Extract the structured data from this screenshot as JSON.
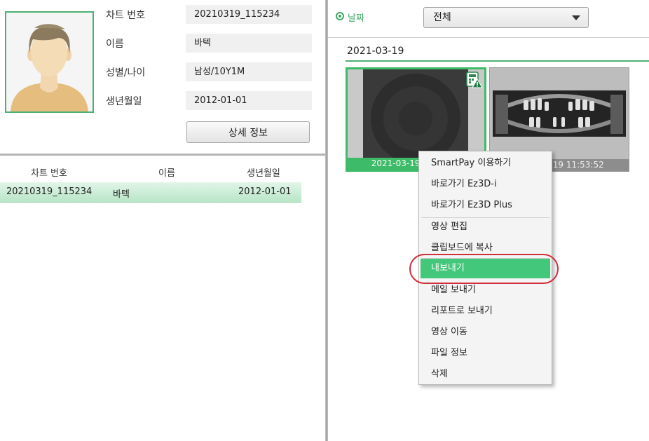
{
  "patient_info": {
    "chart_number_label": "차트 번호",
    "chart_number_value": "20210319_115234",
    "name_label": "이름",
    "name_value": "바텍",
    "gender_age_label": "성별/나이",
    "gender_age_value": "남성/10Y1M",
    "birthdate_label": "생년월일",
    "birthdate_value": "2012-01-01",
    "detail_button": "상세 정보"
  },
  "patient_list": {
    "columns": [
      "차트 번호",
      "이름",
      "생년월일"
    ],
    "rows": [
      {
        "chart_number": "20210319_115234",
        "name": "바텍",
        "birthdate": "2012-01-01"
      }
    ]
  },
  "filter": {
    "radio_label": "날짜",
    "select_value": "전체"
  },
  "image_group": {
    "date": "2021-03-19",
    "thumbnails": [
      {
        "caption": "2021-03-19 11:53:52",
        "selected": true
      },
      {
        "caption": "2021-03-19 11:53:52",
        "selected": false
      }
    ]
  },
  "context_menu": {
    "items": [
      "SmartPay 이용하기",
      "바로가기 Ez3D-i",
      "바로가기 Ez3D Plus",
      "영상 편집",
      "클립보드에 복사",
      "내보내기",
      "메일 보내기",
      "리포트로 보내기",
      "영상 이동",
      "파일 정보",
      "삭제"
    ],
    "highlighted_item": "내보내기"
  },
  "colors": {
    "accent_green": "#43c77a",
    "highlight_ring": "#d32f3a"
  }
}
